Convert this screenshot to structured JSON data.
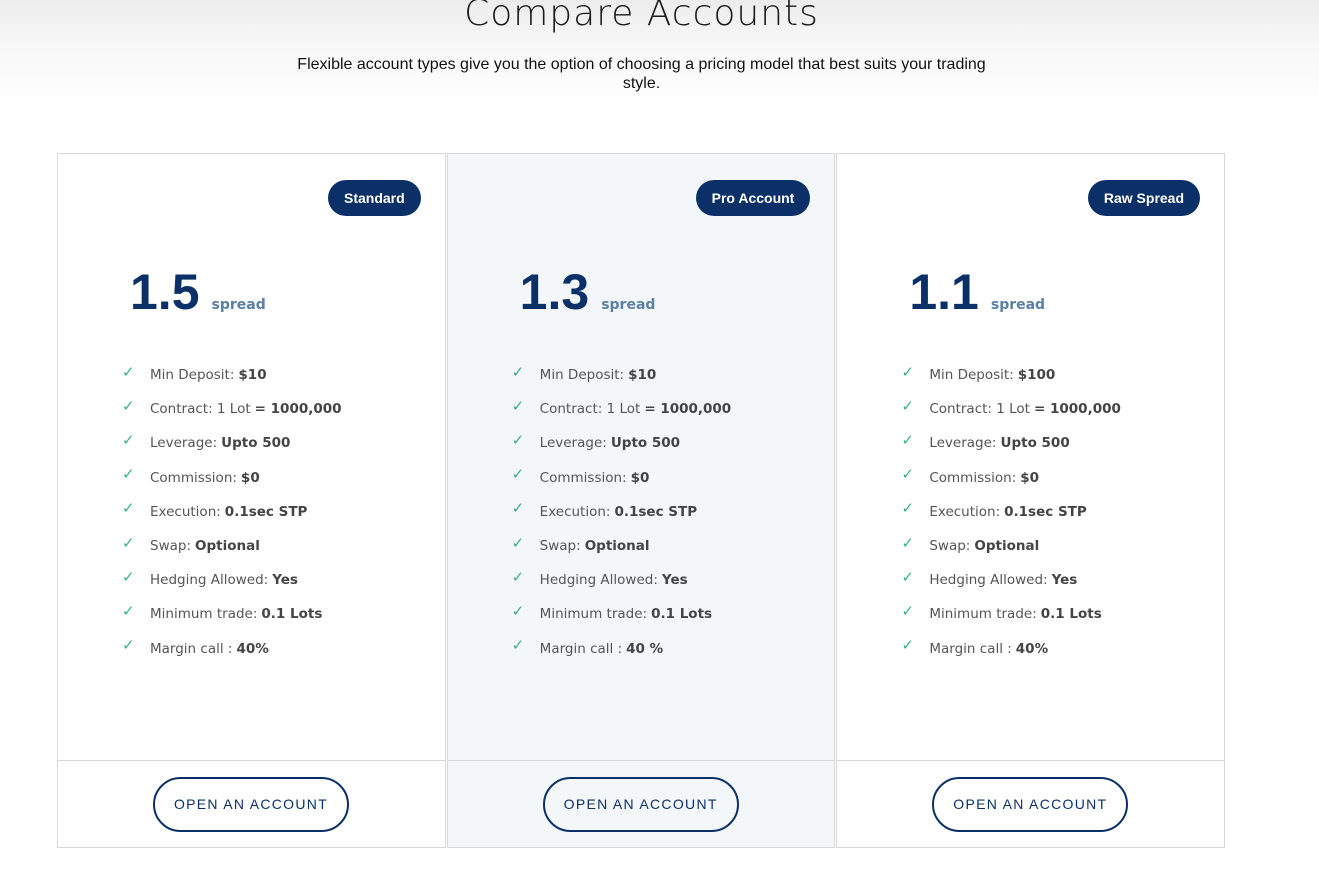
{
  "header": {
    "title": "Compare Accounts",
    "subtitle": "Flexible account types give you the option of choosing a pricing model that best suits your trading style."
  },
  "colors": {
    "brand_navy": "#0b3068",
    "check_green": "#3bb08c",
    "spread_label": "#5b7fa6",
    "featured_bg": "#f3f7fa"
  },
  "icons": {
    "feature_check": "check-icon"
  },
  "accounts": [
    {
      "badge": "Standard",
      "spread_value": "1.5",
      "spread_label": "spread",
      "features": [
        {
          "label": "Min Deposit:",
          "value": "$10"
        },
        {
          "label": "Contract: 1 Lot",
          "value": "= 1000,000"
        },
        {
          "label": "Leverage:",
          "value": "Upto 500"
        },
        {
          "label": "Commission:",
          "value": "$0"
        },
        {
          "label": "Execution:",
          "value": "0.1sec STP"
        },
        {
          "label": "Swap:",
          "value": "Optional"
        },
        {
          "label": "Hedging Allowed:",
          "value": "Yes"
        },
        {
          "label": "Minimum trade:",
          "value": "0.1 Lots"
        },
        {
          "label": "Margin call :",
          "value": "40%"
        }
      ],
      "button": "OPEN AN ACCOUNT"
    },
    {
      "badge": "Pro Account",
      "spread_value": "1.3",
      "spread_label": "spread",
      "features": [
        {
          "label": "Min Deposit:",
          "value": "$10"
        },
        {
          "label": "Contract: 1 Lot",
          "value": "= 1000,000"
        },
        {
          "label": "Leverage:",
          "value": "Upto 500"
        },
        {
          "label": "Commission:",
          "value": "$0"
        },
        {
          "label": "Execution:",
          "value": "0.1sec STP"
        },
        {
          "label": "Swap:",
          "value": "Optional"
        },
        {
          "label": "Hedging Allowed:",
          "value": "Yes"
        },
        {
          "label": "Minimum trade:",
          "value": "0.1 Lots"
        },
        {
          "label": "Margin call :",
          "value": "40 %"
        }
      ],
      "button": "OPEN AN ACCOUNT"
    },
    {
      "badge": "Raw Spread",
      "spread_value": "1.1",
      "spread_label": "spread",
      "features": [
        {
          "label": "Min Deposit:",
          "value": "$100"
        },
        {
          "label": "Contract: 1 Lot",
          "value": "= 1000,000"
        },
        {
          "label": "Leverage:",
          "value": "Upto 500"
        },
        {
          "label": "Commission:",
          "value": "$0"
        },
        {
          "label": "Execution:",
          "value": "0.1sec STP"
        },
        {
          "label": "Swap:",
          "value": "Optional"
        },
        {
          "label": "Hedging Allowed:",
          "value": "Yes"
        },
        {
          "label": "Minimum trade:",
          "value": "0.1 Lots"
        },
        {
          "label": "Margin call :",
          "value": "40%"
        }
      ],
      "button": "OPEN AN ACCOUNT"
    }
  ]
}
